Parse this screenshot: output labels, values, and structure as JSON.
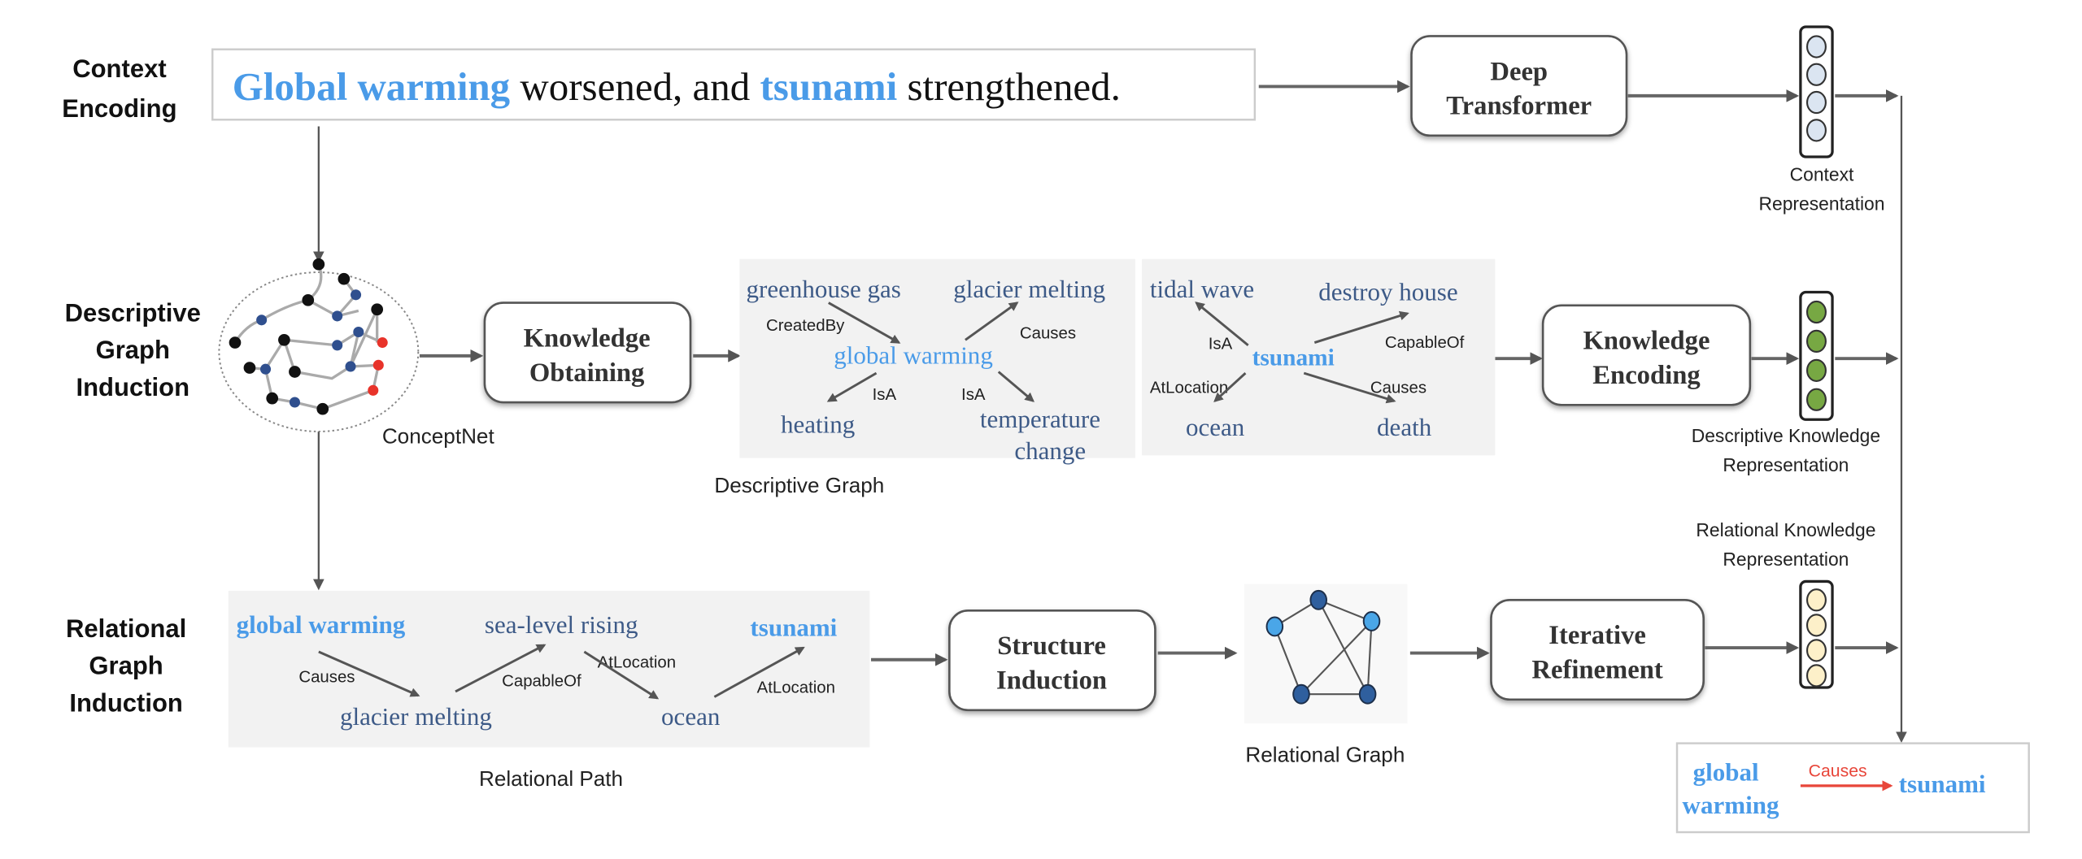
{
  "rows": {
    "context": [
      "Context",
      "Encoding"
    ],
    "descriptive": [
      "Descriptive",
      "Graph",
      "Induction"
    ],
    "relational": [
      "Relational",
      "Graph",
      "Induction"
    ]
  },
  "context_sentence": {
    "key1": "Global warming",
    "mid": " worsened, and ",
    "key2": "tsunami",
    "end": " strengthened."
  },
  "modules": {
    "deep_transformer": [
      "Deep",
      "Transformer"
    ],
    "knowledge_obtaining": [
      "Knowledge",
      "Obtaining"
    ],
    "knowledge_encoding": [
      "Knowledge",
      "Encoding"
    ],
    "structure_induction": [
      "Structure",
      "Induction"
    ],
    "iterative_refinement": [
      "Iterative",
      "Refinement"
    ]
  },
  "representations": {
    "context": {
      "label": [
        "Context",
        "Representation"
      ],
      "color": "#dbe5f1"
    },
    "descriptive": {
      "label": [
        "Descriptive Knowledge",
        "Representation"
      ],
      "color": "#77a843"
    },
    "relational": {
      "label": [
        "Relational Knowledge",
        "Representation"
      ],
      "color": "#fdf0c9"
    }
  },
  "conceptnet_label": "ConceptNet",
  "descriptive_graph": {
    "caption": "Descriptive Graph",
    "global_warming": {
      "center": "global warming",
      "nodes": [
        "greenhouse gas",
        "glacier melting",
        "heating",
        "temperature",
        "change"
      ],
      "relations": [
        "CreatedBy",
        "Causes",
        "IsA",
        "IsA"
      ]
    },
    "tsunami": {
      "center": "tsunami",
      "nodes": [
        "tidal wave",
        "destroy house",
        "ocean",
        "death"
      ],
      "relations": [
        "IsA",
        "CapableOf",
        "AtLocation",
        "Causes"
      ]
    }
  },
  "relational_path": {
    "caption": "Relational Path",
    "nodes": [
      "global warming",
      "sea-level rising",
      "tsunami",
      "glacier melting",
      "ocean"
    ],
    "relations": [
      "Causes",
      "CapableOf",
      "AtLocation",
      "AtLocation"
    ]
  },
  "relational_graph_caption": "Relational Graph",
  "result": {
    "head": [
      "global",
      "warming"
    ],
    "relation": "Causes",
    "tail": "tsunami",
    "relation_color": "#e8463a"
  },
  "colors": {
    "keyword": "#4a9be8",
    "node_text": "#3d5a87",
    "graph_dark": "#2f5f9e",
    "graph_light": "#4aa6e8"
  }
}
